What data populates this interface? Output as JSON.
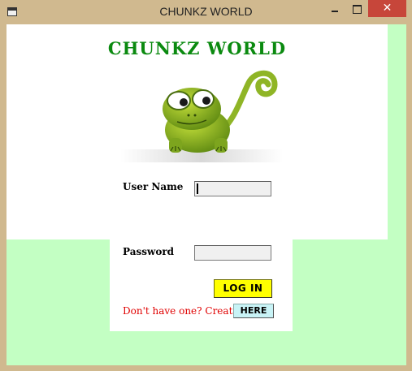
{
  "window": {
    "title": "CHUNKZ WORLD",
    "close_symbol": "✕",
    "icons": [
      "app-icon",
      "minimize-icon",
      "maximize-icon",
      "close-icon"
    ]
  },
  "form": {
    "heading": "CHUNKZ WORLD",
    "mascot_icon": "chameleon-mascot",
    "username_label": "User Name",
    "username_value": "",
    "password_label": "Password",
    "password_value": "",
    "login_label": "LOG IN",
    "signup_text": "Don't have one? Create",
    "here_label": "HERE"
  },
  "colors": {
    "title_green": "#0b8a10",
    "client_bg": "#c3ffc3",
    "login_button": "#ffff00",
    "here_button": "#c8f3f6",
    "signup_text": "#e00000",
    "close_button": "#c7463a"
  }
}
